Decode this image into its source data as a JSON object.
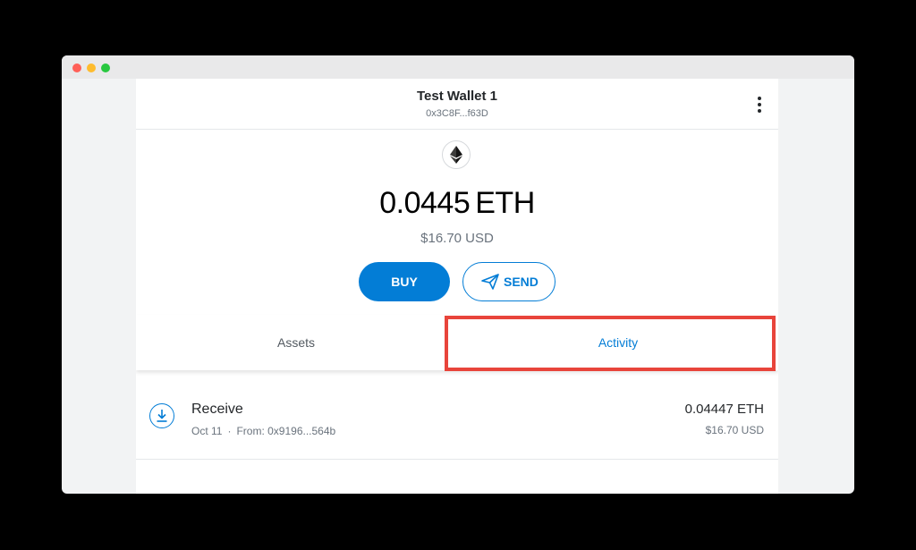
{
  "window": {
    "traffic_colors": [
      "#ff5f57",
      "#febc2e",
      "#28c840"
    ]
  },
  "header": {
    "account_name": "Test Wallet 1",
    "account_address": "0x3C8F...f63D",
    "menu_icon": "kebab-menu-icon"
  },
  "balance": {
    "logo_icon": "ethereum-icon",
    "amount": "0.0445",
    "unit": "ETH",
    "fiat": "$16.70 USD"
  },
  "actions": {
    "buy_label": "BUY",
    "send_label": "SEND",
    "send_icon": "paper-plane-icon",
    "accent_color": "#037dd6"
  },
  "tabs": {
    "items": [
      {
        "label": "Assets",
        "active": false
      },
      {
        "label": "Activity",
        "active": true
      }
    ],
    "highlight_color": "#e8443b"
  },
  "activity": {
    "items": [
      {
        "icon": "receive-icon",
        "title": "Receive",
        "date": "Oct 11",
        "separator": "·",
        "from": "From: 0x9196...564b",
        "amount": "0.04447 ETH",
        "fiat": "$16.70 USD"
      }
    ]
  }
}
